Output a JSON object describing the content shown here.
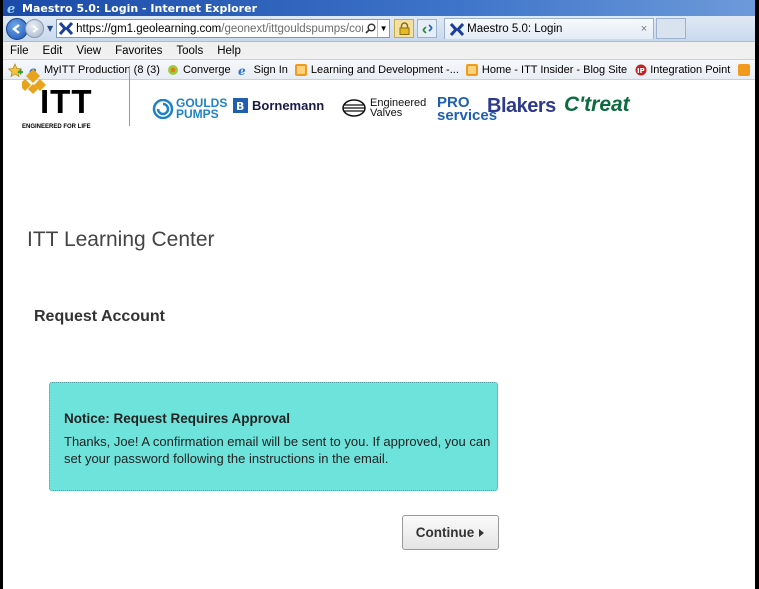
{
  "window": {
    "title": "Maestro 5.0: Login - Internet Explorer"
  },
  "address": {
    "url_host": "https://gm1.geolearning.com",
    "url_path": "/geonext/ittgouldspumps/confirm"
  },
  "tab": {
    "label": "Maestro 5.0: Login",
    "close": "×"
  },
  "menu": [
    "File",
    "Edit",
    "View",
    "Favorites",
    "Tools",
    "Help"
  ],
  "favorites": [
    {
      "label": "MyITT Production (8 (3)",
      "icon": "ie-page-icon"
    },
    {
      "label": "Converge",
      "icon": "converge-icon"
    },
    {
      "label": "Sign In",
      "icon": "ie-page-icon"
    },
    {
      "label": "Learning and Development -...",
      "icon": "feed-icon"
    },
    {
      "label": "Home - ITT Insider - Blog Site",
      "icon": "feed-icon"
    },
    {
      "label": "Integration Point",
      "icon": "ip-icon"
    }
  ],
  "branding": {
    "itt_word": "ITT",
    "itt_tagline": "ENGINEERED FOR LIFE",
    "goulds": "GOULDS PUMPS",
    "bornemann": "Bornemann",
    "engineered_valves": "Engineered Valves",
    "pro_services": "PRO services",
    "blakers": "Blakers",
    "treat": "C'treat"
  },
  "page": {
    "site_title": "ITT Learning Center",
    "heading": "Request Account",
    "notice_title": "Notice: Request Requires Approval",
    "notice_body": "Thanks, Joe! A confirmation email will be sent to you. If approved, you can set your password following the instructions in the email.",
    "continue_label": "Continue"
  },
  "colors": {
    "notice_bg": "#6de3dc",
    "titlebar": "#1b4aa8"
  }
}
